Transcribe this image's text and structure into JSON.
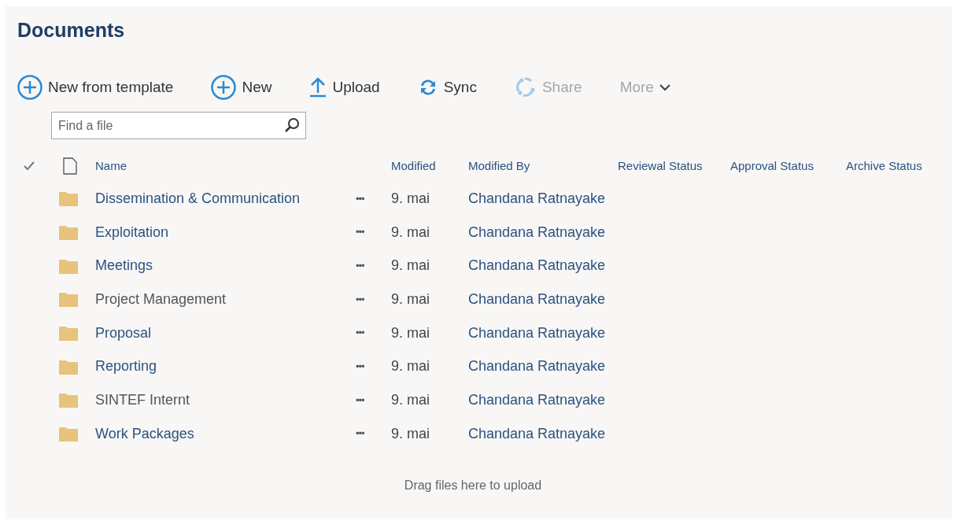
{
  "title": "Documents",
  "toolbar": [
    {
      "kind": "plus",
      "label": "New from template",
      "disabled": false
    },
    {
      "kind": "plus",
      "label": "New",
      "disabled": false
    },
    {
      "kind": "upload",
      "label": "Upload",
      "disabled": false
    },
    {
      "kind": "sync",
      "label": "Sync",
      "disabled": false
    },
    {
      "kind": "share",
      "label": "Share",
      "disabled": true
    },
    {
      "kind": "more",
      "label": "More",
      "disabled": true
    }
  ],
  "search": {
    "placeholder": "Find a file"
  },
  "columns": [
    "Name",
    "Modified",
    "Modified By",
    "Reviewal Status",
    "Approval Status",
    "Archive Status"
  ],
  "rows": [
    {
      "name": "Dissemination & Communication",
      "visited": false,
      "actions": "•••",
      "modified": "9. mai",
      "modified_by": "Chandana Ratnayake"
    },
    {
      "name": "Exploitation",
      "visited": false,
      "actions": "•••",
      "modified": "9. mai",
      "modified_by": "Chandana Ratnayake"
    },
    {
      "name": "Meetings",
      "visited": false,
      "actions": "•••",
      "modified": "9. mai",
      "modified_by": "Chandana Ratnayake"
    },
    {
      "name": "Project Management",
      "visited": true,
      "actions": "•••",
      "modified": "9. mai",
      "modified_by": "Chandana Ratnayake"
    },
    {
      "name": "Proposal",
      "visited": false,
      "actions": "•••",
      "modified": "9. mai",
      "modified_by": "Chandana Ratnayake"
    },
    {
      "name": "Reporting",
      "visited": false,
      "actions": "•••",
      "modified": "9. mai",
      "modified_by": "Chandana Ratnayake"
    },
    {
      "name": "SINTEF Internt",
      "visited": true,
      "actions": "•••",
      "modified": "9. mai",
      "modified_by": "Chandana Ratnayake"
    },
    {
      "name": "Work Packages",
      "visited": false,
      "actions": "•••",
      "modified": "9. mai",
      "modified_by": "Chandana Ratnayake"
    }
  ],
  "footer": "Drag files here to upload"
}
